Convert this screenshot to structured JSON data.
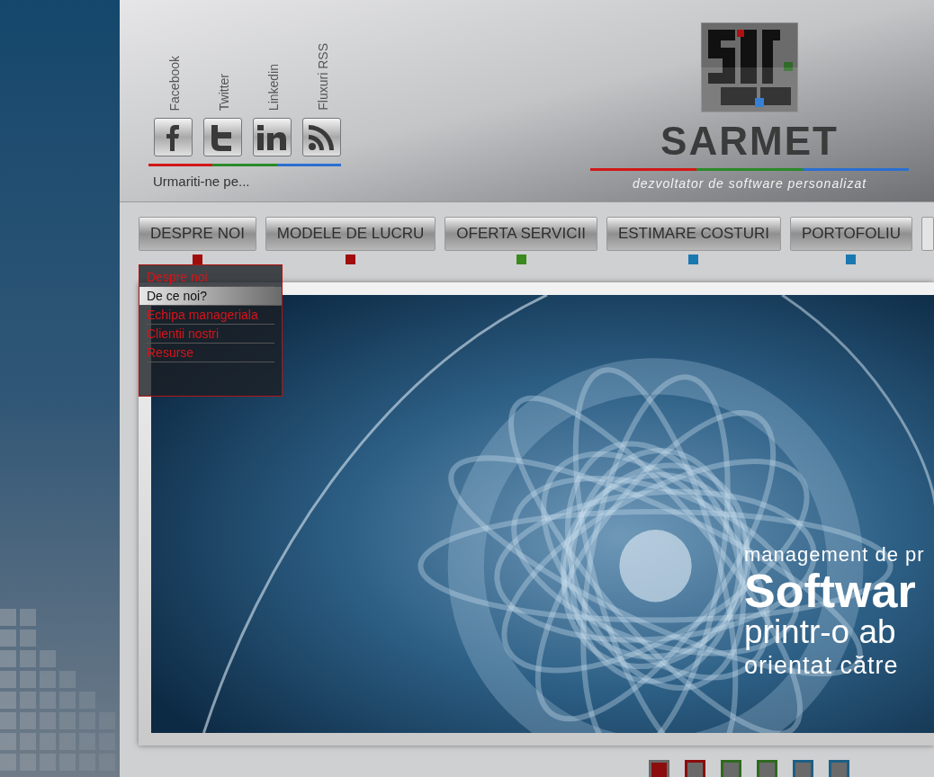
{
  "social": {
    "links": [
      {
        "label": "Facebook",
        "kind": "facebook"
      },
      {
        "label": "Twitter",
        "kind": "twitter"
      },
      {
        "label": "Linkedin",
        "kind": "linkedin"
      },
      {
        "label": "Fluxuri RSS",
        "kind": "rss"
      }
    ],
    "caption": "Urmariti-ne pe..."
  },
  "logo": {
    "name": "SARMET",
    "tagline": "dezvoltator de software personalizat"
  },
  "nav": [
    {
      "label": "DESPRE NOI",
      "color": "#a00d0d"
    },
    {
      "label": "MODELE DE LUCRU",
      "color": "#a00d0d"
    },
    {
      "label": "OFERTA SERVICII",
      "color": "#3a8a1e"
    },
    {
      "label": "ESTIMARE COSTURI",
      "color": "#1a78b0"
    },
    {
      "label": "PORTOFOLIU",
      "color": "#1a78b0"
    }
  ],
  "dropdown": [
    {
      "label": "Despre noi",
      "selected": false
    },
    {
      "label": "De ce noi?",
      "selected": true
    },
    {
      "label": "Echipa manageriala",
      "selected": false
    },
    {
      "label": "Clientii nostri",
      "selected": false
    },
    {
      "label": "Resurse",
      "selected": false
    }
  ],
  "slide": {
    "line_1": "management de pr",
    "line_2": "Softwar",
    "line_3": "printr-o ab",
    "line_4": "orientat către"
  },
  "pager": [
    {
      "color": "#8b0d0d",
      "selected": true
    },
    {
      "color": "#8b0d0d",
      "selected": false
    },
    {
      "color": "#2e6a1e",
      "selected": false
    },
    {
      "color": "#2e6a1e",
      "selected": false
    },
    {
      "color": "#1d5f85",
      "selected": false
    },
    {
      "color": "#1d5f85",
      "selected": false
    }
  ]
}
